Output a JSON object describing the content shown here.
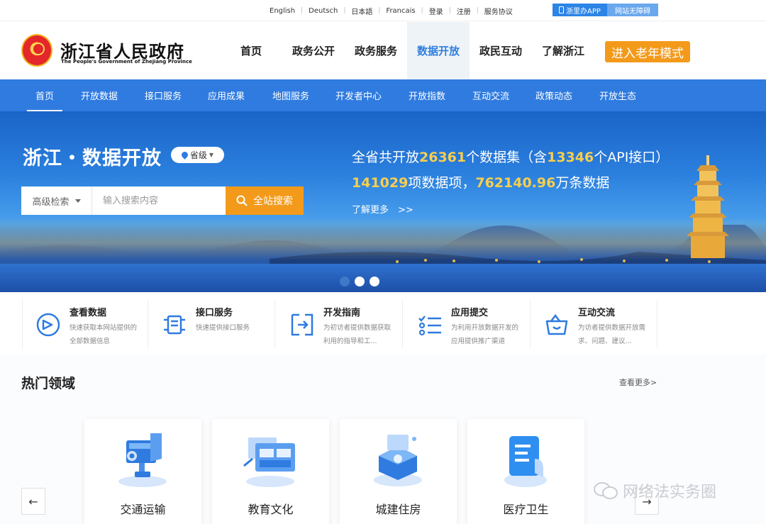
{
  "topbar": {
    "links": [
      "English",
      "Deutsch",
      "日本語",
      "Francais",
      "登录",
      "注册",
      "服务协议"
    ],
    "app_button": "浙里办APP",
    "accessibility_button": "网站无障碍"
  },
  "header": {
    "title": "浙江省人民政府",
    "subtitle": "The People's Government of Zhejiang Province",
    "nav": [
      "首页",
      "政务公开",
      "政务服务",
      "数据开放",
      "政民互动",
      "了解浙江"
    ],
    "active_nav": "数据开放",
    "elder_mode": "进入老年模式"
  },
  "subnav": {
    "items": [
      "首页",
      "开放数据",
      "接口服务",
      "应用成果",
      "地图服务",
      "开发者中心",
      "开放指数",
      "互动交流",
      "政策动态",
      "开放生态"
    ]
  },
  "banner": {
    "title": "浙江・数据开放",
    "region": "省级",
    "search": {
      "advanced": "高级检索",
      "placeholder": "输入搜索内容",
      "button": "全站搜索"
    },
    "stats": {
      "line1_prefix": "全省共开放",
      "datasets": "26361",
      "line1_mid": "个数据集（含",
      "apis": "13346",
      "line1_suffix": "个API接口）",
      "items": "141029",
      "line2_mid": "项数据项，",
      "records": "762140.96",
      "line2_suffix": "万条数据"
    },
    "learn_more": "了解更多　>>",
    "active_slide": 1
  },
  "quick_entries": [
    {
      "title": "查看数据",
      "desc": "快速获取本网站提供的全部数据信息",
      "icon": "view-data-icon"
    },
    {
      "title": "接口服务",
      "desc": "快速提供接口服务",
      "icon": "api-service-icon"
    },
    {
      "title": "开发指南",
      "desc": "为初访者提供数据获取利用的指导和工...",
      "icon": "dev-guide-icon"
    },
    {
      "title": "应用提交",
      "desc": "为利用开放数据开发的应用提供推广渠道",
      "icon": "app-submit-icon"
    },
    {
      "title": "互动交流",
      "desc": "为访者提供数据开放需求、问题、建议...",
      "icon": "interaction-icon"
    }
  ],
  "hot": {
    "title": "热门领域",
    "more": "查看更多>",
    "cards": [
      "交通运输",
      "教育文化",
      "城建住房",
      "医疗卫生"
    ]
  },
  "watermark": "网络法实务圈",
  "colors": {
    "primary": "#2f7be0",
    "accent": "#f39a1b",
    "highlight": "#f7cf4d"
  }
}
